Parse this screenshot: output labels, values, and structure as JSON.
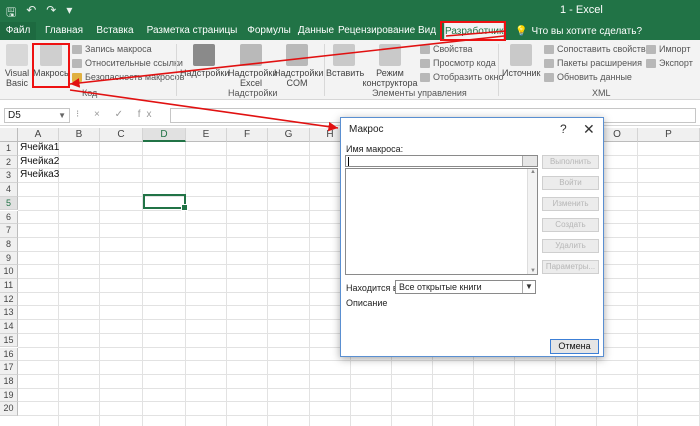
{
  "window": {
    "title": "1 - Excel",
    "qat": [
      "save-icon",
      "undo-icon",
      "redo-icon",
      "customize-icon"
    ]
  },
  "tabs": [
    "Файл",
    "Главная",
    "Вставка",
    "Разметка страницы",
    "Формулы",
    "Данные",
    "Рецензирование",
    "Вид",
    "Разработчик"
  ],
  "active_tab": "Разработчик",
  "tell_me": "Что вы хотите сделать?",
  "ribbon": {
    "code": {
      "visual_basic": "Visual Basic",
      "macros": "Макросы",
      "record_macro": "Запись макроса",
      "relative_refs": "Относительные ссылки",
      "macro_security": "Безопасность макросов",
      "group": "Код"
    },
    "addins": {
      "addins": "Надстройки",
      "excel_addins": "Надстройки Excel",
      "com_addins": "Надстройки COM",
      "group": "Надстройки"
    },
    "controls": {
      "insert": "Вставить",
      "design_mode": "Режим конструктора",
      "properties": "Свойства",
      "view_code": "Просмотр кода",
      "run_dialog": "Отобразить окно",
      "group": "Элементы управления"
    },
    "xml": {
      "source": "Источник",
      "map_properties": "Сопоставить свойства",
      "expansion_packs": "Пакеты расширения",
      "refresh_data": "Обновить данные",
      "import": "Импорт",
      "export": "Экспорт",
      "group": "XML"
    }
  },
  "formula_bar": {
    "name_box": "D5",
    "buttons": "⁝ × ✓ fx",
    "value": ""
  },
  "sheet": {
    "columns": [
      "A",
      "B",
      "C",
      "D",
      "E",
      "F",
      "G",
      "H",
      "I",
      "J",
      "K",
      "L",
      "M",
      "N",
      "O",
      "P"
    ],
    "rows": [
      "1",
      "2",
      "3",
      "4",
      "5",
      "6",
      "7",
      "8",
      "9",
      "10",
      "11",
      "12",
      "13",
      "14",
      "15",
      "16",
      "17",
      "18",
      "19",
      "20"
    ],
    "selected_column": "D",
    "selected_row": "5",
    "cells": [
      {
        "ref": "A1",
        "value": "Ячейка1"
      },
      {
        "ref": "A2",
        "value": "Ячейка2"
      },
      {
        "ref": "A3",
        "value": "Ячейка3"
      }
    ]
  },
  "dialog": {
    "title": "Макрос",
    "help": "?",
    "close": "✕",
    "name_label": "Имя макроса:",
    "name_value": "",
    "buttons": [
      "Выполнить",
      "Войти",
      "Изменить",
      "Создать",
      "Удалить",
      "Параметры..."
    ],
    "location_label": "Находится в:",
    "location_value": "Все открытые книги",
    "description_label": "Описание",
    "cancel": "Отмена"
  },
  "annotation_color": "#e11111"
}
